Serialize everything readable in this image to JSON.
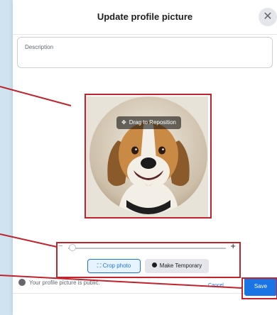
{
  "dialog": {
    "title": "Update profile picture",
    "close_icon": "close-icon",
    "description": {
      "value": "",
      "placeholder": "Description"
    }
  },
  "photo": {
    "drag_label": "Drag to Reposition",
    "drag_icon": "move-icon"
  },
  "zoom": {
    "minus": "−",
    "plus": "+",
    "level": 0.0
  },
  "actions": {
    "crop_icon": "crop-icon",
    "crop_label": "Crop photo",
    "temp_icon": "clock-icon",
    "temp_label": "Make Temporary"
  },
  "privacy": {
    "icon": "globe-icon",
    "text": "Your profile picture is public."
  },
  "footer": {
    "cancel_label": "Cancel",
    "save_label": "Save"
  },
  "colors": {
    "accent": "#1b74e4",
    "annotation": "#c0232c"
  }
}
